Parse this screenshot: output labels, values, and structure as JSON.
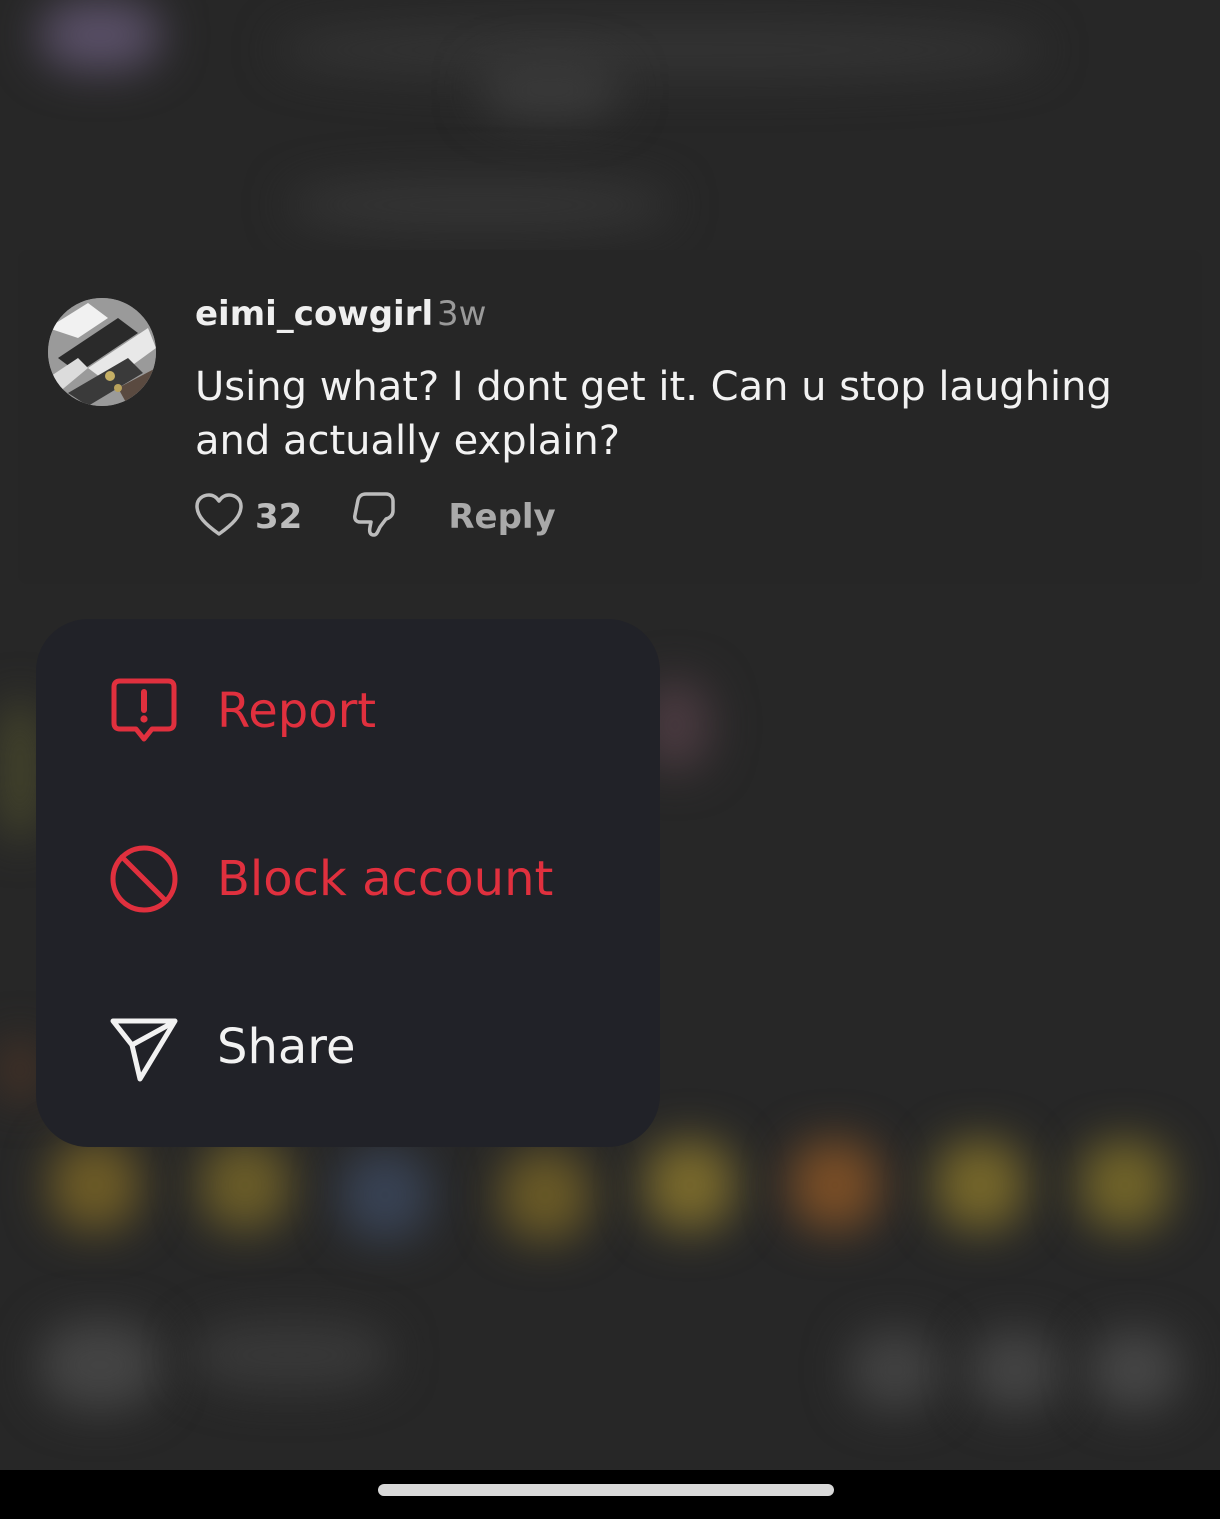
{
  "comment": {
    "username": "eimi_cowgirl",
    "time": "3w",
    "text": "Using what? I dont get it. Can u stop laughing and actually explain?",
    "likes": "32",
    "reply_label": "Reply"
  },
  "menu": {
    "items": [
      {
        "label": "Report",
        "icon": "report-icon"
      },
      {
        "label": "Block account",
        "icon": "block-icon"
      },
      {
        "label": "Share",
        "icon": "share-icon"
      }
    ]
  },
  "colors": {
    "danger": "#e0303e",
    "menu_bg": "#212228",
    "card_bg": "#262626",
    "text_primary": "#f2f2f2",
    "text_muted": "#9a9a9a"
  }
}
